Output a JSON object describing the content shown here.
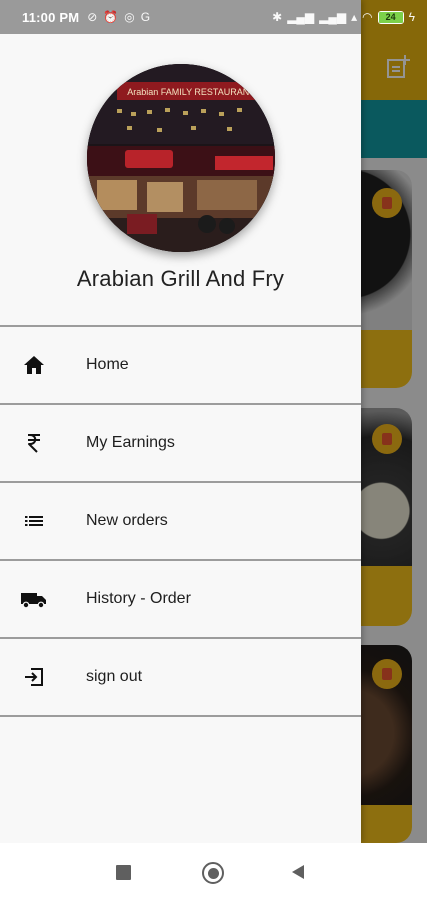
{
  "status_bar": {
    "time": "11:00 PM",
    "left_icons": [
      "no-sync-icon",
      "alarm-icon",
      "whatsapp-icon",
      "google-icon"
    ],
    "right_icons": [
      "bluetooth-icon",
      "signal-icon",
      "signal-icon",
      "volte-icon",
      "wifi-icon"
    ],
    "battery_level": "24",
    "battery_color": "#7cd14a"
  },
  "drawer": {
    "profile_name": "Arabian Grill And Fry",
    "photo_sign_text": "Arabian FAMILY RESTAURANT",
    "menu": [
      {
        "label": "Home",
        "icon": "home-icon"
      },
      {
        "label": "My Earnings",
        "icon": "rupee-icon"
      },
      {
        "label": "New orders",
        "icon": "list-icon"
      },
      {
        "label": "History - Order",
        "icon": "truck-icon"
      },
      {
        "label": "sign out",
        "icon": "sign-out-icon"
      }
    ]
  },
  "background_app": {
    "appbar_color": "#e7b410",
    "tabbar_color": "#129aa3",
    "action_icon": "add-note-icon"
  },
  "nav_bar": {
    "buttons": [
      "recents-button",
      "home-button",
      "back-button"
    ]
  }
}
